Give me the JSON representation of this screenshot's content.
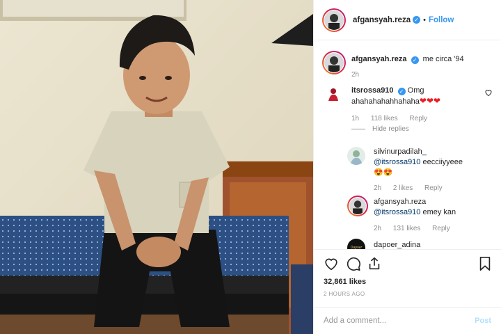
{
  "post": {
    "username": "afgansyah.reza",
    "follow_label": "Follow",
    "dot": "•",
    "caption": "me circa '94",
    "caption_time": "2h"
  },
  "comments": [
    {
      "username": "itsrossa910",
      "verified": true,
      "text": "Omg ahahahahahhahaha",
      "emoji": "❤❤❤",
      "time": "1h",
      "likes": "118 likes",
      "reply_label": "Reply",
      "hide_replies_label": "Hide replies"
    }
  ],
  "replies": [
    {
      "username": "silvinurpadilah_",
      "mention": "@itsrossa910",
      "text": " eecciiyyeee",
      "emoji": "😍😍",
      "time": "2h",
      "likes": "2 likes",
      "reply_label": "Reply"
    },
    {
      "username": "afgansyah.reza",
      "mention": "@itsrossa910",
      "text": " emey kan",
      "time": "2h",
      "likes": "131 likes",
      "reply_label": "Reply"
    },
    {
      "username": "dapoer_adina",
      "avatar_text": "Dapoer"
    }
  ],
  "footer": {
    "likes": "32,861 likes",
    "time_ago": "2 HOURS AGO",
    "comment_placeholder": "Add a comment...",
    "post_label": "Post"
  },
  "icons": {
    "heart": "heart-icon",
    "comment": "comment-icon",
    "share": "share-icon",
    "bookmark": "bookmark-icon",
    "verified": "verified-badge-icon"
  },
  "colors": {
    "accent": "#3897f0",
    "post_disabled": "#b2dffc",
    "muted": "#8e8e8e"
  }
}
